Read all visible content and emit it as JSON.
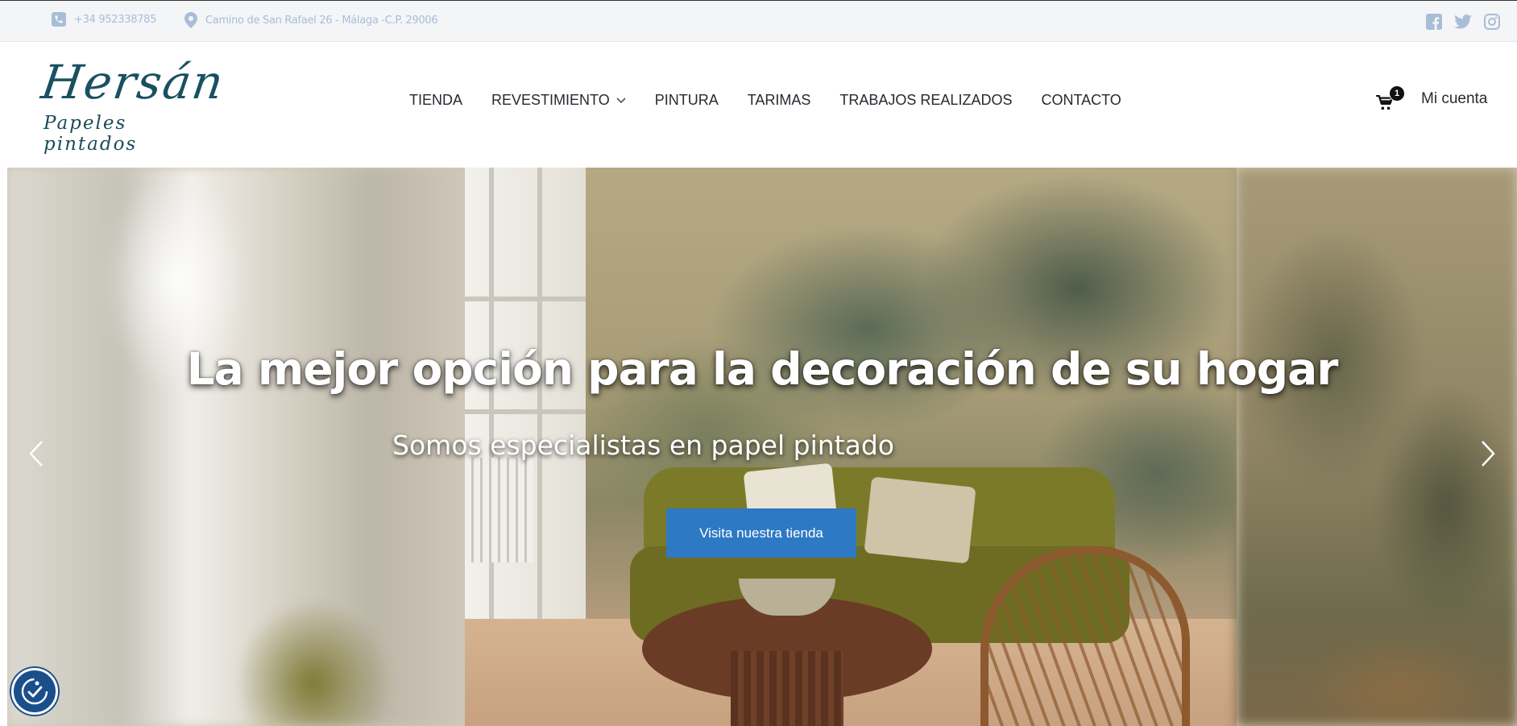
{
  "topbar": {
    "phone": "+34 952338785",
    "address": "Camino de San Rafael 26 - Málaga -C.P. 29006",
    "phone_icon": "phone-icon",
    "address_icon": "map-pin-icon",
    "socials": [
      "facebook-icon",
      "twitter-icon",
      "instagram-icon"
    ]
  },
  "header": {
    "logo": {
      "brand": "Hersán",
      "tagline": "Papeles pintados"
    },
    "nav": [
      "TIENDA",
      "REVESTIMIENTO",
      "PINTURA",
      "TARIMAS",
      "TRABAJOS REALIZADOS",
      "CONTACTO"
    ],
    "cart_count": "1",
    "account_label": "Mi cuenta"
  },
  "hero": {
    "title": "La mejor opción para la decoración de su hogar",
    "subtitle": "Somos especialistas en papel pintado",
    "cta_label": "Visita nuestra tienda"
  },
  "colors": {
    "accent": "#2d79c3",
    "topbar_text": "#a9bdd8",
    "logo": "#1a5161",
    "nav_text": "#262a31",
    "a11y_button": "#1b4f8c"
  }
}
